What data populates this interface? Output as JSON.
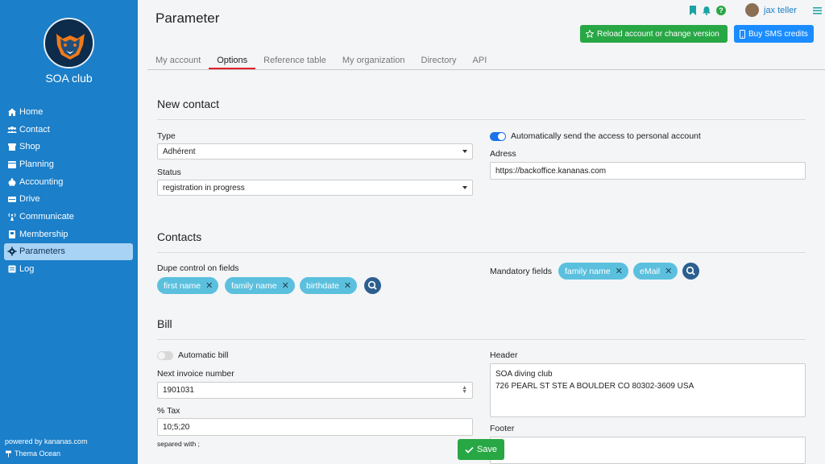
{
  "sidebar": {
    "club_name": "SOA club",
    "items": [
      {
        "label": "Home",
        "icon": "home-icon"
      },
      {
        "label": "Contact",
        "icon": "users-icon"
      },
      {
        "label": "Shop",
        "icon": "shop-icon"
      },
      {
        "label": "Planning",
        "icon": "calendar-icon"
      },
      {
        "label": "Accounting",
        "icon": "piggy-bank-icon"
      },
      {
        "label": "Drive",
        "icon": "drive-icon"
      },
      {
        "label": "Communicate",
        "icon": "broadcast-icon"
      },
      {
        "label": "Membership",
        "icon": "id-card-icon"
      },
      {
        "label": "Parameters",
        "icon": "gear-icon",
        "active": true
      },
      {
        "label": "Log",
        "icon": "log-icon"
      }
    ],
    "powered_by": "powered by kananas.com",
    "theme": "Thema Ocean"
  },
  "header": {
    "title": "Parameter",
    "user_name": "jax teller",
    "reload_button": "Reload account or change version",
    "sms_button": "Buy SMS credits"
  },
  "tabs": [
    {
      "label": "My account"
    },
    {
      "label": "Options",
      "active": true
    },
    {
      "label": "Reference table"
    },
    {
      "label": "My organization"
    },
    {
      "label": "Directory"
    },
    {
      "label": "API"
    }
  ],
  "new_contact": {
    "title": "New contact",
    "type_label": "Type",
    "type_value": "Adhérent",
    "status_label": "Status",
    "status_value": "registration in progress",
    "auto_send_label": "Automatically send the access to personal account",
    "auto_send_on": true,
    "address_label": "Adress",
    "address_value": "https://backoffice.kananas.com"
  },
  "contacts": {
    "title": "Contacts",
    "dupe_label": "Dupe control on fields",
    "dupe_fields": [
      "first name",
      "family name",
      "birthdate"
    ],
    "mandatory_label": "Mandatory fields",
    "mandatory_fields": [
      "family name",
      "eMail"
    ]
  },
  "bill": {
    "title": "Bill",
    "auto_bill_label": "Automatic bill",
    "auto_bill_on": false,
    "next_invoice_label": "Next invoice number",
    "next_invoice_value": "1901031",
    "tax_label": "% Tax",
    "tax_value": "10;5;20",
    "tax_hint": "separed with ;",
    "header_label": "Header",
    "header_line1": "SOA diving club",
    "header_line2": "726 PEARL ST STE A BOULDER CO 80302-3609 USA",
    "footer_label": "Footer"
  },
  "save_button": "Save",
  "colors": {
    "sidebar": "#1b7fc9",
    "success": "#28a745",
    "primary": "#1a8cff",
    "chip": "#5bc0de",
    "active_tab_underline": "#e0202a"
  }
}
